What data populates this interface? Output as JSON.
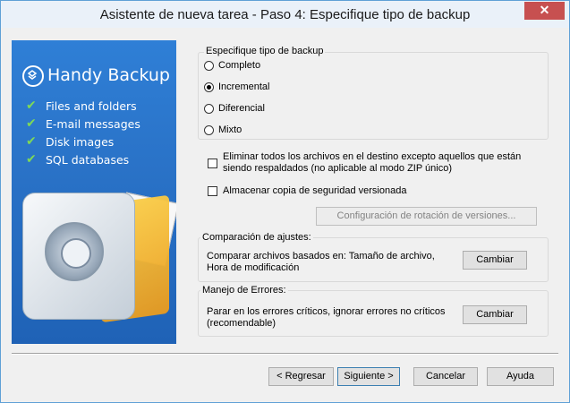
{
  "window": {
    "title": "Asistente de nueva tarea - Paso 4: Especifique tipo de backup",
    "close_glyph": "✕"
  },
  "banner": {
    "brand": "Handy Backup",
    "features": [
      "Files and folders",
      "E-mail messages",
      "Disk images",
      "SQL databases"
    ]
  },
  "backup_type": {
    "legend": "Especifique tipo de backup",
    "options": [
      {
        "label": "Completo",
        "selected": false
      },
      {
        "label": "Incremental",
        "selected": true
      },
      {
        "label": "Diferencial",
        "selected": false
      },
      {
        "label": "Mixto",
        "selected": false
      }
    ]
  },
  "options": {
    "delete_label": "Eliminar todos los archivos en el destino excepto aquellos que están siendo respaldados (no aplicable al modo ZIP único)",
    "delete_checked": false,
    "versioned_label": "Almacenar copia de seguridad versionada",
    "versioned_checked": false,
    "rotation_button": "Configuración de rotación de versiones..."
  },
  "compare": {
    "legend": "Comparación de ajustes:",
    "text": "Comparar archivos basados en: Tamaño de archivo, Hora de modificación",
    "button": "Cambiar"
  },
  "errors": {
    "legend": "Manejo de Errores:",
    "text": "Parar en los errores críticos, ignorar errores no críticos (recomendable)",
    "button": "Cambiar"
  },
  "footer": {
    "back": "< Regresar",
    "next": "Siguiente >",
    "cancel": "Cancelar",
    "help": "Ayuda"
  }
}
